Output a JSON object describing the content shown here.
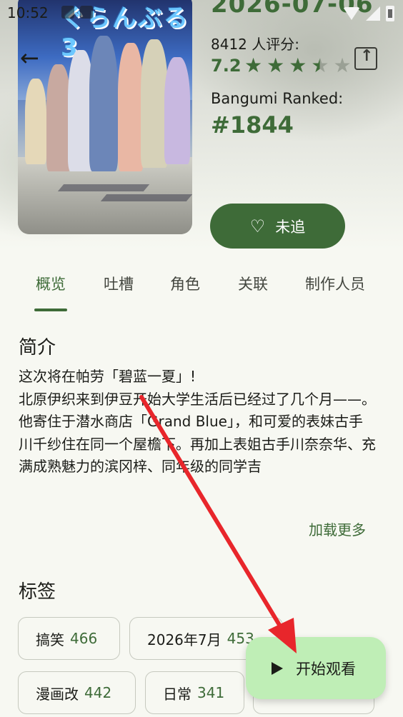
{
  "status_bar": {
    "time": "10:52"
  },
  "header": {
    "cover_title": "ぐらんぶる3",
    "air_date": "2026-07-06",
    "rating_count_label": "8412 人评分:",
    "rating_score": "7.2",
    "rating_stars": 3.5,
    "rank_label": "Bangumi Ranked:",
    "rank_value": "#1844",
    "follow_button_label": "未追"
  },
  "tabs": [
    "概览",
    "吐槽",
    "角色",
    "关联",
    "制作人员"
  ],
  "active_tab": "概览",
  "summary": {
    "title": "简介",
    "text": "这次将在帕劳「碧蓝一夏」!\n北原伊织来到伊豆开始大学生活后已经过了几个月——。\n他寄住于潜水商店「Grand Blue」，和可爱的表妹古手川千纱住在同一个屋檐下。再加上表姐古手川奈奈华、充满成熟魅力的滨冈梓、同年级的同学吉",
    "load_more": "加载更多"
  },
  "tags": {
    "title": "标签",
    "items": [
      {
        "name": "搞笑",
        "count": "466"
      },
      {
        "name": "2026年7月",
        "count": "453"
      },
      {
        "name": "漫画改",
        "count": "442"
      },
      {
        "name": "日常",
        "count": "341"
      }
    ]
  },
  "fab": {
    "label": "开始观看"
  },
  "colors": {
    "accent": "#3e6b38",
    "fab_bg": "#bfeeb6",
    "annotation_arrow": "#e8262b"
  }
}
